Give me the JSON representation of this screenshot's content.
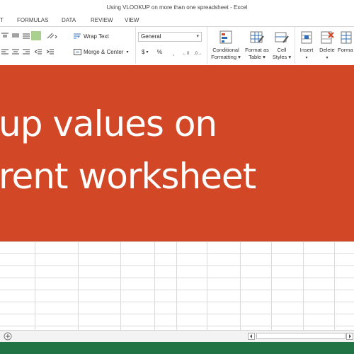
{
  "window": {
    "title": "Using VLOOKUP on more than one spreadsheet - Excel"
  },
  "tabs": [
    {
      "label": "T"
    },
    {
      "label": "FORMULAS"
    },
    {
      "label": "DATA"
    },
    {
      "label": "REVIEW"
    },
    {
      "label": "VIEW"
    }
  ],
  "ribbon": {
    "wrap_text": "Wrap Text",
    "merge_center": "Merge & Center",
    "number_format": "General",
    "currency_symbol": "$",
    "percent_symbol": "%",
    "conditional_formatting": [
      "Conditional",
      "Formatting ▾"
    ],
    "format_as_table": [
      "Format as",
      "Table ▾"
    ],
    "cell_styles": [
      "Cell",
      "Styles ▾"
    ],
    "insert": "Insert",
    "delete": "Delete",
    "format": "Forma"
  },
  "banner": {
    "line1": "up values on",
    "line2": "rent worksheet",
    "color": "#d24726"
  },
  "status": {
    "color": "#217346"
  }
}
